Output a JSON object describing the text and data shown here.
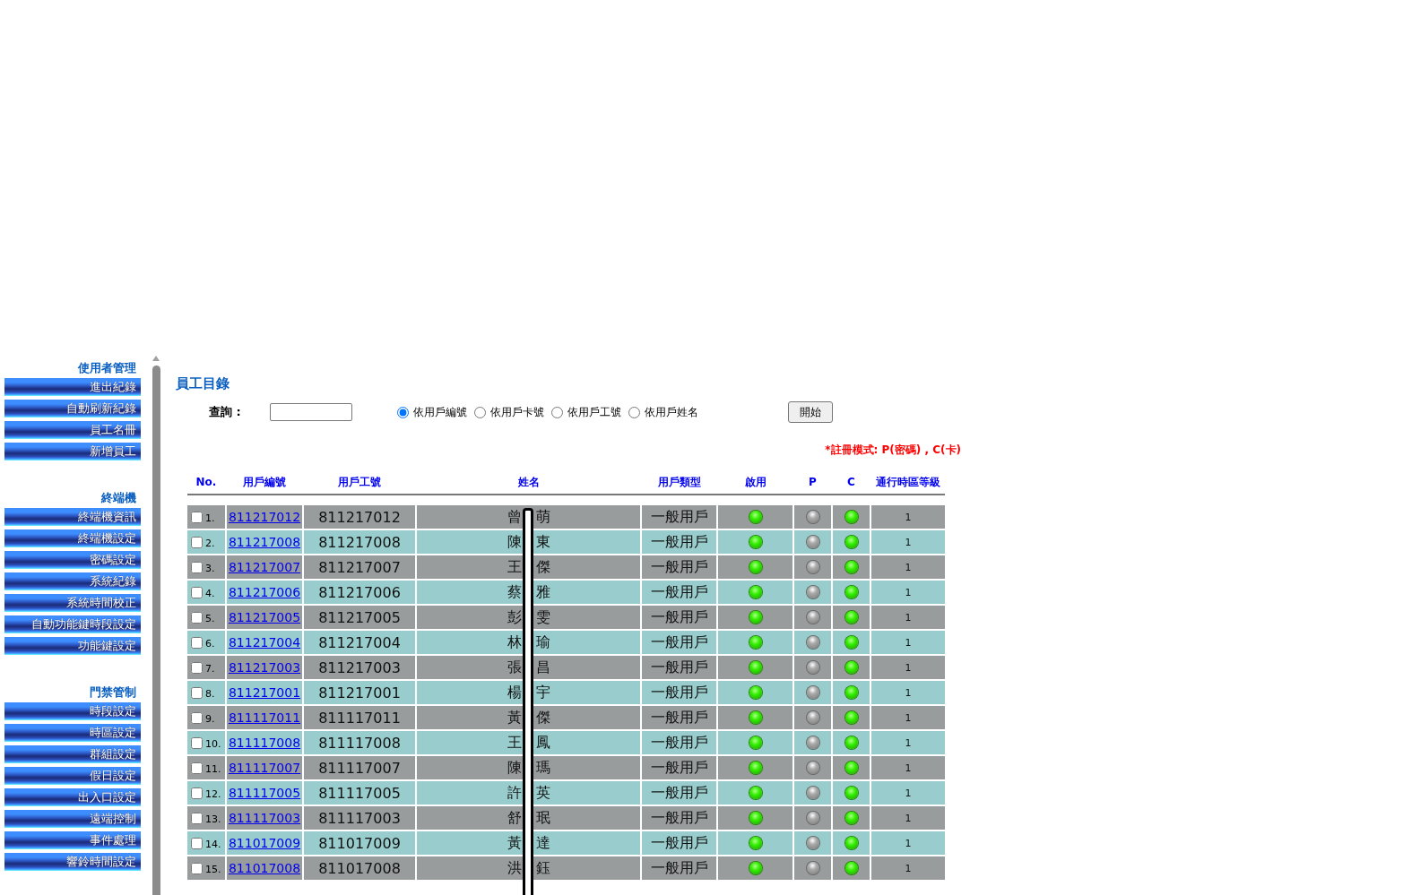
{
  "sidebar": [
    {
      "title": "使用者管理",
      "items": [
        "進出紀錄",
        "自動刷新紀錄",
        "員工名冊",
        "新增員工"
      ]
    },
    {
      "title": "終端機",
      "items": [
        "終端機資訊",
        "終端機設定",
        "密碼設定",
        "系統紀錄",
        "系統時間校正",
        "自動功能鍵時段設定",
        "功能鍵設定"
      ]
    },
    {
      "title": "門禁管制",
      "items": [
        "時段設定",
        "時區設定",
        "群組設定",
        "假日設定",
        "出入口設定",
        "遠端控制",
        "事件處理",
        "響鈴時間設定"
      ]
    }
  ],
  "page_title": "員工目錄",
  "query": {
    "label": "查詢 :",
    "options": [
      {
        "label": "依用戶編號",
        "selected": true
      },
      {
        "label": "依用戶卡號",
        "selected": false
      },
      {
        "label": "依用戶工號",
        "selected": false
      },
      {
        "label": "依用戶姓名",
        "selected": false
      }
    ],
    "button": "開始"
  },
  "note": "*註冊模式: P(密碼) , C(卡)",
  "columns": [
    "No.",
    "用戶編號",
    "用戶工號",
    "姓名",
    "用戶類型",
    "啟用",
    "P",
    "C",
    "通行時區等級"
  ],
  "rows": [
    {
      "no": "1.",
      "checked": false,
      "id": "811217012",
      "emp_no": "811217012",
      "surname": "曾",
      "given": "萌",
      "type": "一般用戶",
      "enabled": true,
      "p": false,
      "c": true,
      "level": "1"
    },
    {
      "no": "2.",
      "checked": false,
      "id": "811217008",
      "emp_no": "811217008",
      "surname": "陳",
      "given": "東",
      "type": "一般用戶",
      "enabled": true,
      "p": false,
      "c": true,
      "level": "1"
    },
    {
      "no": "3.",
      "checked": false,
      "id": "811217007",
      "emp_no": "811217007",
      "surname": "王",
      "given": "傑",
      "type": "一般用戶",
      "enabled": true,
      "p": false,
      "c": true,
      "level": "1"
    },
    {
      "no": "4.",
      "checked": false,
      "id": "811217006",
      "emp_no": "811217006",
      "surname": "蔡",
      "given": "雅",
      "type": "一般用戶",
      "enabled": true,
      "p": false,
      "c": true,
      "level": "1"
    },
    {
      "no": "5.",
      "checked": false,
      "id": "811217005",
      "emp_no": "811217005",
      "surname": "彭",
      "given": "雯",
      "type": "一般用戶",
      "enabled": true,
      "p": false,
      "c": true,
      "level": "1"
    },
    {
      "no": "6.",
      "checked": false,
      "id": "811217004",
      "emp_no": "811217004",
      "surname": "林",
      "given": "瑜",
      "type": "一般用戶",
      "enabled": true,
      "p": false,
      "c": true,
      "level": "1"
    },
    {
      "no": "7.",
      "checked": false,
      "id": "811217003",
      "emp_no": "811217003",
      "surname": "張",
      "given": "昌",
      "type": "一般用戶",
      "enabled": true,
      "p": false,
      "c": true,
      "level": "1"
    },
    {
      "no": "8.",
      "checked": false,
      "id": "811217001",
      "emp_no": "811217001",
      "surname": "楊",
      "given": "宇",
      "type": "一般用戶",
      "enabled": true,
      "p": false,
      "c": true,
      "level": "1"
    },
    {
      "no": "9.",
      "checked": false,
      "id": "811117011",
      "emp_no": "811117011",
      "surname": "黃",
      "given": "傑",
      "type": "一般用戶",
      "enabled": true,
      "p": false,
      "c": true,
      "level": "1"
    },
    {
      "no": "10.",
      "checked": false,
      "id": "811117008",
      "emp_no": "811117008",
      "surname": "王",
      "given": "鳳",
      "type": "一般用戶",
      "enabled": true,
      "p": false,
      "c": true,
      "level": "1"
    },
    {
      "no": "11.",
      "checked": false,
      "id": "811117007",
      "emp_no": "811117007",
      "surname": "陳",
      "given": "瑪",
      "type": "一般用戶",
      "enabled": true,
      "p": false,
      "c": true,
      "level": "1"
    },
    {
      "no": "12.",
      "checked": false,
      "id": "811117005",
      "emp_no": "811117005",
      "surname": "許",
      "given": "英",
      "type": "一般用戶",
      "enabled": true,
      "p": false,
      "c": true,
      "level": "1"
    },
    {
      "no": "13.",
      "checked": false,
      "id": "811117003",
      "emp_no": "811117003",
      "surname": "舒",
      "given": "珉",
      "type": "一般用戶",
      "enabled": true,
      "p": false,
      "c": true,
      "level": "1"
    },
    {
      "no": "14.",
      "checked": false,
      "id": "811017009",
      "emp_no": "811017009",
      "surname": "黃",
      "given": "達",
      "type": "一般用戶",
      "enabled": true,
      "p": false,
      "c": true,
      "level": "1"
    },
    {
      "no": "15.",
      "checked": false,
      "id": "811017008",
      "emp_no": "811017008",
      "surname": "洪",
      "given": "鈺",
      "type": "一般用戶",
      "enabled": true,
      "p": false,
      "c": true,
      "level": "1"
    }
  ]
}
